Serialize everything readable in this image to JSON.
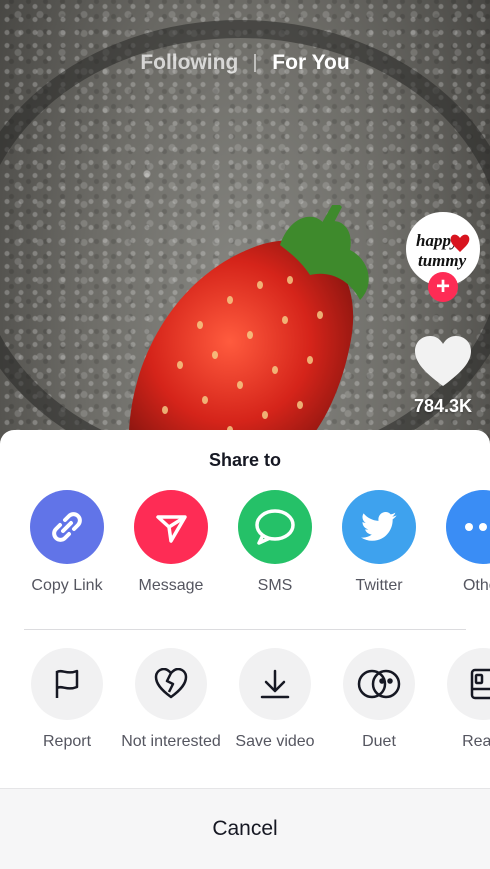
{
  "nav": {
    "following": "Following",
    "for_you": "For You"
  },
  "creator": {
    "logo_line1": "happy",
    "logo_line2": "tummy",
    "follow_symbol": "+"
  },
  "likes": {
    "count": "784.3K"
  },
  "share_sheet": {
    "title": "Share to",
    "share_targets": [
      {
        "label": "Copy Link",
        "icon": "link-icon",
        "color": "#6174e8"
      },
      {
        "label": "Message",
        "icon": "send-icon",
        "color": "#fe2c55"
      },
      {
        "label": "SMS",
        "icon": "sms-icon",
        "color": "#25c168"
      },
      {
        "label": "Twitter",
        "icon": "twitter-icon",
        "color": "#3ea2ee"
      },
      {
        "label": "Other",
        "icon": "more-icon",
        "color": "#3a8df5"
      }
    ],
    "actions": [
      {
        "label": "Report",
        "icon": "flag-icon"
      },
      {
        "label": "Not interested",
        "icon": "broken-heart-icon"
      },
      {
        "label": "Save video",
        "icon": "download-icon"
      },
      {
        "label": "Duet",
        "icon": "duet-icon"
      },
      {
        "label": "React",
        "icon": "react-icon"
      }
    ],
    "cancel": "Cancel"
  }
}
